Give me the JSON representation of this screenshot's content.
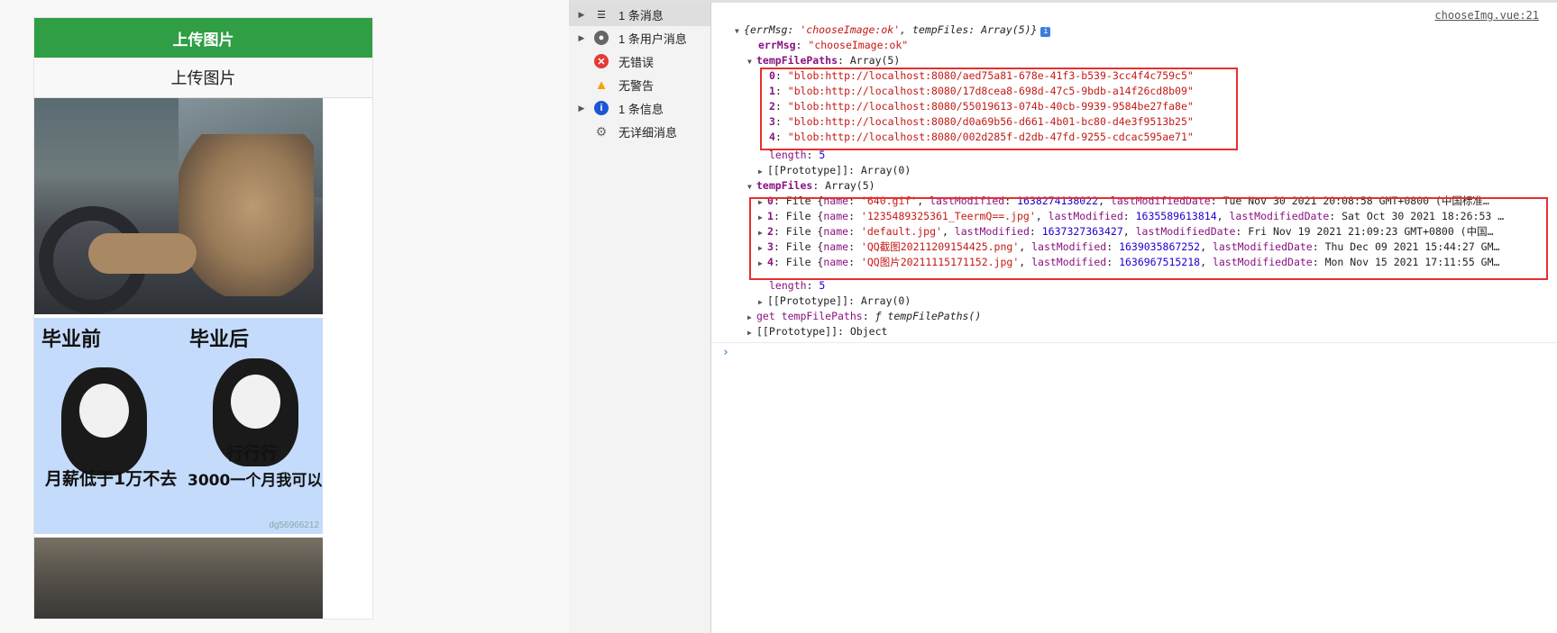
{
  "preview": {
    "navbar_title": "上传图片",
    "upload_button": "上传图片",
    "meme": {
      "before_label": "毕业前",
      "after_label": "毕业后",
      "caption_left": "月薪低于1万不去",
      "caption_right_1": "行行行",
      "caption_right_2": "3000一个月我可以",
      "watermark": "dg56966212"
    }
  },
  "sidebar": {
    "items": [
      {
        "label": "1 条消息",
        "icon": "list-icon",
        "expandable": true,
        "selected": true
      },
      {
        "label": "1 条用户消息",
        "icon": "user-icon",
        "expandable": true
      },
      {
        "label": "无错误",
        "icon": "error-icon"
      },
      {
        "label": "无警告",
        "icon": "warning-icon"
      },
      {
        "label": "1 条信息",
        "icon": "info-icon",
        "expandable": true
      },
      {
        "label": "无详细消息",
        "icon": "gear-icon"
      }
    ]
  },
  "console": {
    "source_link": "chooseImg.vue:21",
    "summary": {
      "open": "{",
      "errMsg_key": "errMsg",
      "errMsg_val": "'chooseImage:ok'",
      "sep": ", ",
      "tf_key": "tempFiles",
      "tf_val": "Array(5)",
      "close": "}"
    },
    "errMsg": {
      "key": "errMsg",
      "value": "\"chooseImage:ok\""
    },
    "tempFilePaths": {
      "key": "tempFilePaths",
      "type": "Array(5)",
      "items": [
        "\"blob:http://localhost:8080/aed75a81-678e-41f3-b539-3cc4f4c759c5\"",
        "\"blob:http://localhost:8080/17d8cea8-698d-47c5-9bdb-a14f26cd8b09\"",
        "\"blob:http://localhost:8080/55019613-074b-40cb-9939-9584be27fa8e\"",
        "\"blob:http://localhost:8080/d0a69b56-d661-4b01-bc80-d4e3f9513b25\"",
        "\"blob:http://localhost:8080/002d285f-d2db-47fd-9255-cdcac595ae71\""
      ],
      "length": "5",
      "prototype": "Array(0)"
    },
    "tempFiles": {
      "key": "tempFiles",
      "type": "Array(5)",
      "items": [
        {
          "name": "'640.gif'",
          "lastModified": "1638274138022",
          "date": "Tue Nov 30 2021 20:08:58 GMT+0800 (中国标准…"
        },
        {
          "name": "'1235489325361_TeermQ==.jpg'",
          "lastModified": "1635589613814",
          "date": "Sat Oct 30 2021 18:26:53 …"
        },
        {
          "name": "'default.jpg'",
          "lastModified": "1637327363427",
          "date": "Fri Nov 19 2021 21:09:23 GMT+0800 (中国…"
        },
        {
          "name": "'QQ截图20211209154425.png'",
          "lastModified": "1639035867252",
          "date": "Thu Dec 09 2021 15:44:27 GM…"
        },
        {
          "name": "'QQ图片20211115171152.jpg'",
          "lastModified": "1636967515218",
          "date": "Mon Nov 15 2021 17:11:55 GM…"
        }
      ],
      "length": "5",
      "prototype": "Array(0)"
    },
    "getter": {
      "key": "get tempFilePaths",
      "value": "ƒ tempFilePaths()"
    },
    "object_prototype": "Object",
    "labels": {
      "length": "length",
      "prototype": "[[Prototype]]",
      "file": "File",
      "name": "name",
      "lastModified": "lastModified",
      "lastModifiedDate": "lastModifiedDate"
    }
  }
}
